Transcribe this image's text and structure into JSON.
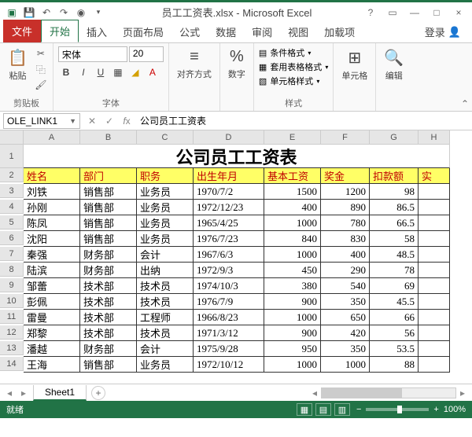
{
  "title": "员工工资表.xlsx - Microsoft Excel",
  "tabs": {
    "file": "文件",
    "home": "开始",
    "insert": "插入",
    "layout": "页面布局",
    "formulas": "公式",
    "data": "数据",
    "review": "审阅",
    "view": "视图",
    "addins": "加载项",
    "login": "登录"
  },
  "ribbon": {
    "clipboard": {
      "paste": "粘贴",
      "label": "剪贴板"
    },
    "font": {
      "name": "宋体",
      "size": "20",
      "label": "字体"
    },
    "align": {
      "btn": "对齐方式",
      "label": ""
    },
    "number": {
      "btn": "数字",
      "label": ""
    },
    "styles": {
      "cond": "条件格式",
      "tbl": "套用表格格式",
      "cell": "单元格样式",
      "label": "样式"
    },
    "cells": {
      "btn": "单元格"
    },
    "editing": {
      "btn": "编辑"
    }
  },
  "namebox": "OLE_LINK1",
  "formula": "公司员工工资表",
  "cols": [
    "A",
    "B",
    "C",
    "D",
    "E",
    "F",
    "G",
    "H"
  ],
  "sheet_title": "公司员工工资表",
  "headers": [
    "姓名",
    "部门",
    "职务",
    "出生年月",
    "基本工资",
    "奖金",
    "扣款额",
    "实"
  ],
  "rows": [
    [
      "刘铁",
      "销售部",
      "业务员",
      "1970/7/2",
      "1500",
      "1200",
      "98",
      ""
    ],
    [
      "孙刚",
      "销售部",
      "业务员",
      "1972/12/23",
      "400",
      "890",
      "86.5",
      ""
    ],
    [
      "陈凤",
      "销售部",
      "业务员",
      "1965/4/25",
      "1000",
      "780",
      "66.5",
      ""
    ],
    [
      "沈阳",
      "销售部",
      "业务员",
      "1976/7/23",
      "840",
      "830",
      "58",
      ""
    ],
    [
      "秦强",
      "财务部",
      "会计",
      "1967/6/3",
      "1000",
      "400",
      "48.5",
      ""
    ],
    [
      "陆滨",
      "财务部",
      "出纳",
      "1972/9/3",
      "450",
      "290",
      "78",
      ""
    ],
    [
      "邹蕾",
      "技术部",
      "技术员",
      "1974/10/3",
      "380",
      "540",
      "69",
      ""
    ],
    [
      "彭佩",
      "技术部",
      "技术员",
      "1976/7/9",
      "900",
      "350",
      "45.5",
      ""
    ],
    [
      "雷曼",
      "技术部",
      "工程师",
      "1966/8/23",
      "1000",
      "650",
      "66",
      ""
    ],
    [
      "郑黎",
      "技术部",
      "技术员",
      "1971/3/12",
      "900",
      "420",
      "56",
      ""
    ],
    [
      "潘越",
      "财务部",
      "会计",
      "1975/9/28",
      "950",
      "350",
      "53.5",
      ""
    ],
    [
      "王海",
      "销售部",
      "业务员",
      "1972/10/12",
      "1000",
      "1000",
      "88",
      ""
    ]
  ],
  "sheet": "Sheet1",
  "status": "就绪",
  "zoom": "100%",
  "chart_data": {
    "type": "table",
    "title": "公司员工工资表",
    "columns": [
      "姓名",
      "部门",
      "职务",
      "出生年月",
      "基本工资",
      "奖金",
      "扣款额"
    ],
    "data": [
      {
        "姓名": "刘铁",
        "部门": "销售部",
        "职务": "业务员",
        "出生年月": "1970/7/2",
        "基本工资": 1500,
        "奖金": 1200,
        "扣款额": 98
      },
      {
        "姓名": "孙刚",
        "部门": "销售部",
        "职务": "业务员",
        "出生年月": "1972/12/23",
        "基本工资": 400,
        "奖金": 890,
        "扣款额": 86.5
      },
      {
        "姓名": "陈凤",
        "部门": "销售部",
        "职务": "业务员",
        "出生年月": "1965/4/25",
        "基本工资": 1000,
        "奖金": 780,
        "扣款额": 66.5
      },
      {
        "姓名": "沈阳",
        "部门": "销售部",
        "职务": "业务员",
        "出生年月": "1976/7/23",
        "基本工资": 840,
        "奖金": 830,
        "扣款额": 58
      },
      {
        "姓名": "秦强",
        "部门": "财务部",
        "职务": "会计",
        "出生年月": "1967/6/3",
        "基本工资": 1000,
        "奖金": 400,
        "扣款额": 48.5
      },
      {
        "姓名": "陆滨",
        "部门": "财务部",
        "职务": "出纳",
        "出生年月": "1972/9/3",
        "基本工资": 450,
        "奖金": 290,
        "扣款额": 78
      },
      {
        "姓名": "邹蕾",
        "部门": "技术部",
        "职务": "技术员",
        "出生年月": "1974/10/3",
        "基本工资": 380,
        "奖金": 540,
        "扣款额": 69
      },
      {
        "姓名": "彭佩",
        "部门": "技术部",
        "职务": "技术员",
        "出生年月": "1976/7/9",
        "基本工资": 900,
        "奖金": 350,
        "扣款额": 45.5
      },
      {
        "姓名": "雷曼",
        "部门": "技术部",
        "职务": "工程师",
        "出生年月": "1966/8/23",
        "基本工资": 1000,
        "奖金": 650,
        "扣款额": 66
      },
      {
        "姓名": "郑黎",
        "部门": "技术部",
        "职务": "技术员",
        "出生年月": "1971/3/12",
        "基本工资": 900,
        "奖金": 420,
        "扣款额": 56
      },
      {
        "姓名": "潘越",
        "部门": "财务部",
        "职务": "会计",
        "出生年月": "1975/9/28",
        "基本工资": 950,
        "奖金": 350,
        "扣款额": 53.5
      },
      {
        "姓名": "王海",
        "部门": "销售部",
        "职务": "业务员",
        "出生年月": "1972/10/12",
        "基本工资": 1000,
        "奖金": 1000,
        "扣款额": 88
      }
    ]
  }
}
